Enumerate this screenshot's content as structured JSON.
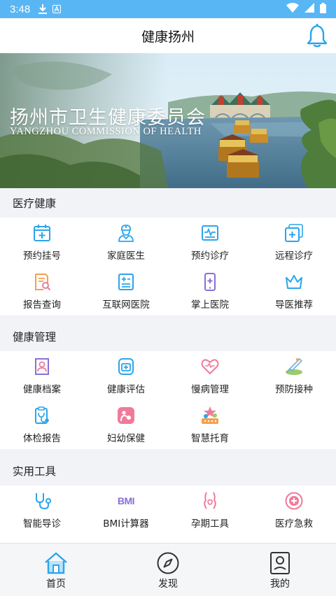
{
  "status_bar": {
    "time": "3:48"
  },
  "header": {
    "title": "健康扬州"
  },
  "banner": {
    "title_zh": "扬州市卫生健康委员会",
    "title_en": "YANGZHOU COMMISSION OF HEALTH"
  },
  "sections": [
    {
      "title": "医疗健康",
      "items": [
        {
          "label": "预约挂号",
          "icon": "calendar-plus-icon"
        },
        {
          "label": "家庭医生",
          "icon": "doctor-icon"
        },
        {
          "label": "预约诊疗",
          "icon": "vitals-card-icon"
        },
        {
          "label": "远程诊疗",
          "icon": "remote-card-icon"
        },
        {
          "label": "报告查询",
          "icon": "report-search-icon"
        },
        {
          "label": "互联网医院",
          "icon": "internet-hospital-icon"
        },
        {
          "label": "掌上医院",
          "icon": "mobile-hospital-icon"
        },
        {
          "label": "导医推荐",
          "icon": "crown-icon"
        }
      ]
    },
    {
      "title": "健康管理",
      "items": [
        {
          "label": "健康档案",
          "icon": "health-file-icon"
        },
        {
          "label": "健康评估",
          "icon": "health-assess-icon"
        },
        {
          "label": "慢病管理",
          "icon": "heart-rate-icon"
        },
        {
          "label": "预防接种",
          "icon": "vaccine-icon"
        },
        {
          "label": "体检报告",
          "icon": "checkup-report-icon"
        },
        {
          "label": "妇幼保健",
          "icon": "maternal-child-icon"
        },
        {
          "label": "智慧托育",
          "icon": "childcare-icon"
        }
      ]
    },
    {
      "title": "实用工具",
      "items": [
        {
          "label": "智能导诊",
          "icon": "stethoscope-icon"
        },
        {
          "label": "BMI计算器",
          "icon": "bmi-icon"
        },
        {
          "label": "孕期工具",
          "icon": "pregnancy-icon"
        },
        {
          "label": "医疗急救",
          "icon": "first-aid-icon"
        }
      ]
    }
  ],
  "bmi_icon_text": "BMI",
  "tabs": [
    {
      "label": "首页",
      "icon": "home-icon",
      "active": true
    },
    {
      "label": "发现",
      "icon": "compass-icon",
      "active": false
    },
    {
      "label": "我的",
      "icon": "profile-icon",
      "active": false
    }
  ],
  "colors": {
    "primary": "#2aa5ec",
    "status_bar": "#59b6f4",
    "accent_pink": "#f07a9a",
    "accent_orange": "#f5a04a"
  }
}
